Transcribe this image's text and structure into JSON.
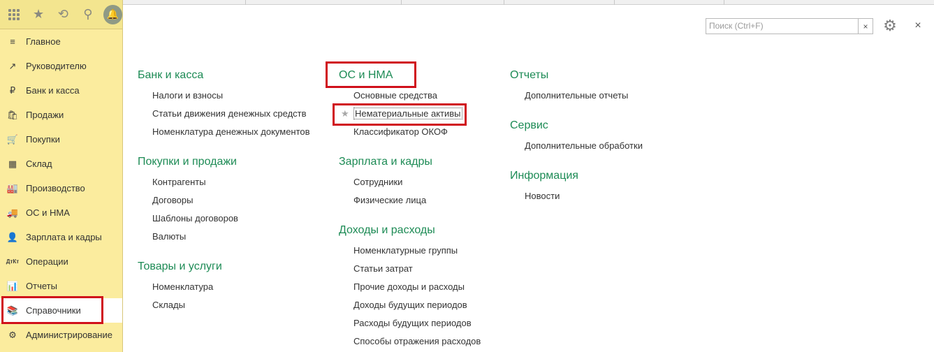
{
  "sidebar": {
    "toolbar": {
      "apps_icon": "grid-icon",
      "favorites_icon": "star-icon",
      "history_icon": "history-icon",
      "search_icon": "search-icon",
      "notifications_icon": "bell-icon"
    },
    "items": [
      {
        "label": "Главное",
        "icon": "≡"
      },
      {
        "label": "Руководителю",
        "icon": "↗"
      },
      {
        "label": "Банк и касса",
        "icon": "₽"
      },
      {
        "label": "Продажи",
        "icon": "🛍"
      },
      {
        "label": "Покупки",
        "icon": "🛒"
      },
      {
        "label": "Склад",
        "icon": "▦"
      },
      {
        "label": "Производство",
        "icon": "🏭"
      },
      {
        "label": "ОС и НМА",
        "icon": "🚚"
      },
      {
        "label": "Зарплата и кадры",
        "icon": "👤"
      },
      {
        "label": "Операции",
        "icon": "ДтКт"
      },
      {
        "label": "Отчеты",
        "icon": "📊"
      },
      {
        "label": "Справочники",
        "icon": "📚"
      },
      {
        "label": "Администрирование",
        "icon": "⚙"
      }
    ],
    "active_index": 11
  },
  "search": {
    "placeholder": "Поиск (Ctrl+F)",
    "clear": "×"
  },
  "controls": {
    "settings_icon": "gear-icon",
    "close": "×"
  },
  "columns": [
    {
      "groups": [
        {
          "title": "Банк и касса",
          "items": [
            "Налоги и взносы",
            "Статьи движения денежных средств",
            "Номенклатура денежных документов"
          ]
        },
        {
          "title": "Покупки и продажи",
          "items": [
            "Контрагенты",
            "Договоры",
            "Шаблоны договоров",
            "Валюты"
          ]
        },
        {
          "title": "Товары и услуги",
          "items": [
            "Номенклатура",
            "Склады"
          ]
        }
      ]
    },
    {
      "groups": [
        {
          "title": "ОС и НМА",
          "items": [
            "Основные средства",
            "Нематериальные активы",
            "Классификатор ОКОФ"
          ]
        },
        {
          "title": "Зарплата и кадры",
          "items": [
            "Сотрудники",
            "Физические лица"
          ]
        },
        {
          "title": "Доходы и расходы",
          "items": [
            "Номенклатурные группы",
            "Статьи затрат",
            "Прочие доходы и расходы",
            "Доходы будущих периодов",
            "Расходы будущих периодов",
            "Способы отражения расходов"
          ]
        }
      ]
    },
    {
      "groups": [
        {
          "title": "Отчеты",
          "items": [
            "Дополнительные отчеты"
          ]
        },
        {
          "title": "Сервис",
          "items": [
            "Дополнительные обработки"
          ]
        },
        {
          "title": "Информация",
          "items": [
            "Новости"
          ]
        }
      ]
    }
  ]
}
